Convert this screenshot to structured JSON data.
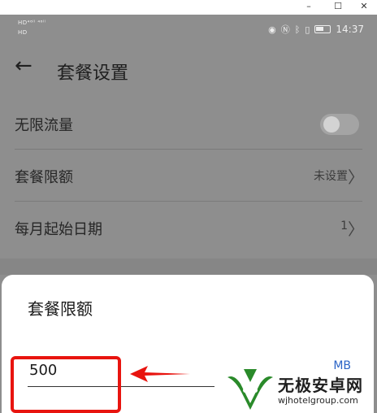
{
  "window": {
    "minimize": "–",
    "maximize": "☐",
    "close": "✕"
  },
  "statusbar": {
    "sim_top": "HD⁴⁶ˡˡ ⁴⁶ˡˡ",
    "sim_bottom": "HD",
    "icons": [
      "eye-icon",
      "nfc-icon",
      "bluetooth-icon",
      "vibrate-icon",
      "battery-icon"
    ],
    "eye": "◉",
    "nfc": "Ⓝ",
    "bt": "ᛒ",
    "vib": "▯",
    "time": "14:37"
  },
  "header": {
    "back": "←",
    "title": "套餐设置"
  },
  "settings": {
    "unlimited_label": "无限流量",
    "unlimited_on": false,
    "limit_label": "套餐限额",
    "limit_value": "未设置",
    "start_label": "每月起始日期",
    "start_value": "1",
    "chevron": "〉"
  },
  "dialog": {
    "title": "套餐限额",
    "input_value": "500",
    "unit": "MB"
  },
  "watermark": {
    "name": "无极安卓网",
    "url": "wjhotelgroup.com"
  },
  "colors": {
    "highlight": "#e8140f",
    "accent": "#2b64c6",
    "overlay": "#8e8e8e"
  }
}
